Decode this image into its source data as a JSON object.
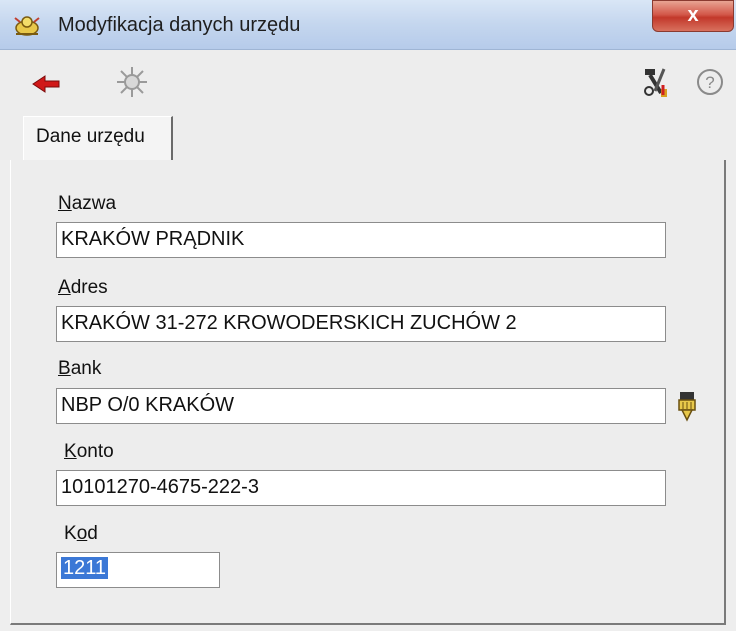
{
  "window": {
    "title": "Modyfikacja danych urzędu",
    "close_glyph": "x"
  },
  "toolbar": {
    "back_icon": "back-arrow-icon",
    "cancel_icon": "cancel-sun-icon",
    "tools_icon": "tools-icon",
    "help_icon": "help-icon",
    "help_glyph": "?"
  },
  "tabs": [
    {
      "label": "Dane urzędu"
    }
  ],
  "form": {
    "nazwa": {
      "label_first": "N",
      "label_rest": "azwa",
      "value": "KRAKÓW PRĄDNIK"
    },
    "adres": {
      "label_first": "A",
      "label_rest": "dres",
      "value": "KRAKÓW 31-272 KROWODERSKICH ZUCHÓW 2"
    },
    "bank": {
      "label_first": "B",
      "label_rest": "ank",
      "value": "NBP O/0 KRAKÓW"
    },
    "konto": {
      "label_first": "K",
      "label_rest": "onto",
      "value": "10101270-4675-222-3"
    },
    "kod": {
      "label_before": "K",
      "label_under": "o",
      "label_after": "d",
      "value": "1211"
    }
  },
  "colors": {
    "selection": "#3b78d6",
    "title_gradient_top": "#d9e6f6",
    "close_red": "#c2382a"
  }
}
